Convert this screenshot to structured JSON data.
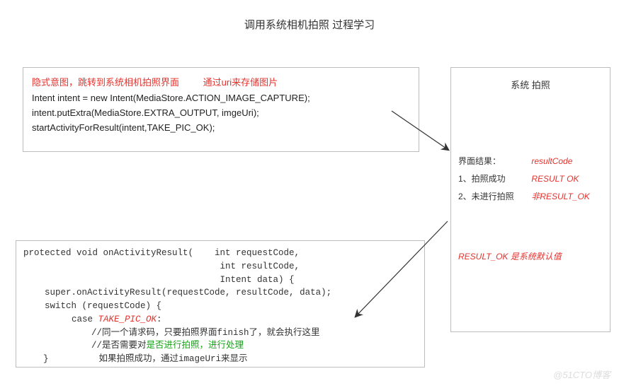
{
  "title": "调用系统相机拍照 过程学习",
  "box1": {
    "note_left": "隐式意图，跳转到系统相机拍照界面",
    "note_right": "通过uri来存储图片",
    "code1": "Intent intent = new Intent(MediaStore.ACTION_IMAGE_CAPTURE);",
    "code2": "intent.putExtra(MediaStore.EXTRA_OUTPUT, imgeUri);",
    "code3": "startActivityForResult(intent,TAKE_PIC_OK);"
  },
  "box2": {
    "title": "系统 拍照",
    "result_label": "界面结果：",
    "result_code": "resultCode",
    "r1_label": "1、拍照成功",
    "r1_val": "RESULT OK",
    "r2_label": "2、未进行拍照",
    "r2_val": "非RESULT_OK",
    "note": "RESULT_OK 是系统默认值"
  },
  "box3": {
    "sig_l1": "protected void onActivityResult(    int requestCode,",
    "sig_l2": "                                     int resultCode,",
    "sig_l3": "                                     Intent data) {",
    "super": "    super.onActivityResult(requestCode, resultCode, data);",
    "switch": "    switch (requestCode) {",
    "case_kw": "case  ",
    "case_val": "TAKE_PIC_OK",
    "case_colon": ":",
    "cmt1": "//同一个请求码，只要拍照界面finish了，就会执行这里",
    "cmt2a": "//是否需要对",
    "cmt2b": "是否进行拍照，进行处理",
    "close": "}",
    "cmt3": "如果拍照成功，通过imageUri来显示"
  },
  "watermark": "@51CTO博客"
}
